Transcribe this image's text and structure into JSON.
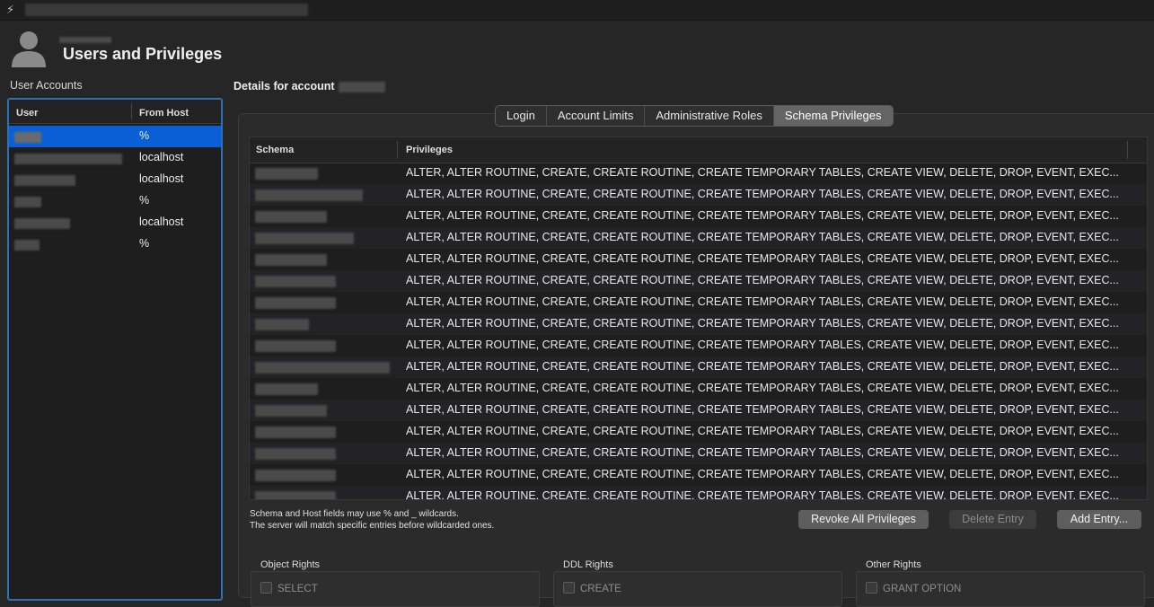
{
  "header": {
    "title": "Users and Privileges"
  },
  "accounts": {
    "label": "User Accounts",
    "col_user": "User",
    "col_host": "From Host",
    "rows": [
      {
        "host": "%",
        "selected": true
      },
      {
        "host": "localhost",
        "selected": false
      },
      {
        "host": "localhost",
        "selected": false
      },
      {
        "host": "%",
        "selected": false
      },
      {
        "host": "localhost",
        "selected": false
      },
      {
        "host": "%",
        "selected": false
      }
    ]
  },
  "details": {
    "label": "Details for account",
    "tabs": [
      "Login",
      "Account Limits",
      "Administrative Roles",
      "Schema Privileges"
    ],
    "active_tab": "Schema Privileges",
    "table": {
      "col_schema": "Schema",
      "col_privileges": "Privileges",
      "rows": [
        "ALTER, ALTER ROUTINE, CREATE, CREATE ROUTINE, CREATE TEMPORARY TABLES, CREATE VIEW, DELETE, DROP, EVENT, EXEC...",
        "ALTER, ALTER ROUTINE, CREATE, CREATE ROUTINE, CREATE TEMPORARY TABLES, CREATE VIEW, DELETE, DROP, EVENT, EXEC...",
        "ALTER, ALTER ROUTINE, CREATE, CREATE ROUTINE, CREATE TEMPORARY TABLES, CREATE VIEW, DELETE, DROP, EVENT, EXEC...",
        "ALTER, ALTER ROUTINE, CREATE, CREATE ROUTINE, CREATE TEMPORARY TABLES, CREATE VIEW, DELETE, DROP, EVENT, EXEC...",
        "ALTER, ALTER ROUTINE, CREATE, CREATE ROUTINE, CREATE TEMPORARY TABLES, CREATE VIEW, DELETE, DROP, EVENT, EXEC...",
        "ALTER, ALTER ROUTINE, CREATE, CREATE ROUTINE, CREATE TEMPORARY TABLES, CREATE VIEW, DELETE, DROP, EVENT, EXEC...",
        "ALTER, ALTER ROUTINE, CREATE, CREATE ROUTINE, CREATE TEMPORARY TABLES, CREATE VIEW, DELETE, DROP, EVENT, EXEC...",
        "ALTER, ALTER ROUTINE, CREATE, CREATE ROUTINE, CREATE TEMPORARY TABLES, CREATE VIEW, DELETE, DROP, EVENT, EXEC...",
        "ALTER, ALTER ROUTINE, CREATE, CREATE ROUTINE, CREATE TEMPORARY TABLES, CREATE VIEW, DELETE, DROP, EVENT, EXEC...",
        "ALTER, ALTER ROUTINE, CREATE, CREATE ROUTINE, CREATE TEMPORARY TABLES, CREATE VIEW, DELETE, DROP, EVENT, EXEC...",
        "ALTER, ALTER ROUTINE, CREATE, CREATE ROUTINE, CREATE TEMPORARY TABLES, CREATE VIEW, DELETE, DROP, EVENT, EXEC...",
        "ALTER, ALTER ROUTINE, CREATE, CREATE ROUTINE, CREATE TEMPORARY TABLES, CREATE VIEW, DELETE, DROP, EVENT, EXEC...",
        "ALTER, ALTER ROUTINE, CREATE, CREATE ROUTINE, CREATE TEMPORARY TABLES, CREATE VIEW, DELETE, DROP, EVENT, EXEC...",
        "ALTER, ALTER ROUTINE, CREATE, CREATE ROUTINE, CREATE TEMPORARY TABLES, CREATE VIEW, DELETE, DROP, EVENT, EXEC...",
        "ALTER, ALTER ROUTINE, CREATE, CREATE ROUTINE, CREATE TEMPORARY TABLES, CREATE VIEW, DELETE, DROP, EVENT, EXEC...",
        "ALTER, ALTER ROUTINE, CREATE, CREATE ROUTINE, CREATE TEMPORARY TABLES, CREATE VIEW, DELETE, DROP, EVENT, EXEC..."
      ]
    },
    "hint_line1": "Schema and Host fields may use % and _ wildcards.",
    "hint_line2": "The server will match specific entries before wildcarded ones.",
    "buttons": {
      "revoke": "Revoke All Privileges",
      "delete": "Delete Entry",
      "add": "Add Entry..."
    },
    "rights": {
      "object": {
        "title": "Object Rights",
        "first": "SELECT"
      },
      "ddl": {
        "title": "DDL Rights",
        "first": "CREATE"
      },
      "other": {
        "title": "Other Rights",
        "first": "GRANT OPTION"
      }
    }
  },
  "colors": {
    "selection": "#0a5fd6",
    "focus_ring": "#2a72b5",
    "background": "#262626"
  },
  "icons": {
    "app": "bolt-icon",
    "user": "user-avatar-icon"
  }
}
